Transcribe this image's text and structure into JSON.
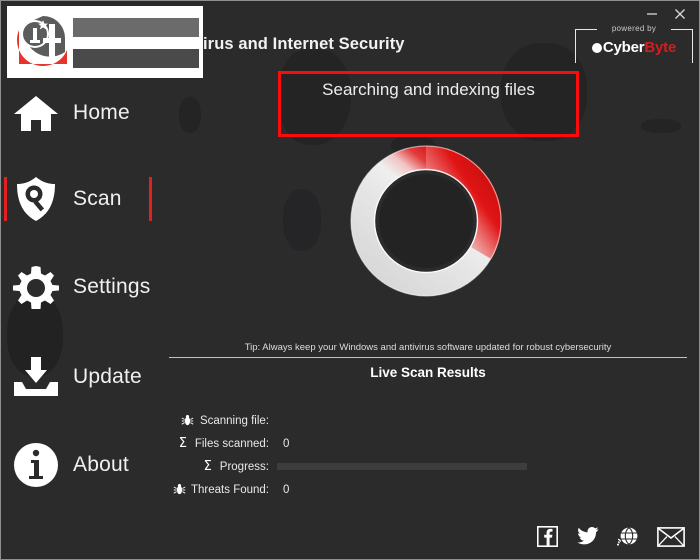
{
  "window": {
    "title": "irus and Internet Security",
    "minimize_label": "—",
    "close_label": "✕"
  },
  "branding": {
    "powered_by_label": "powered by",
    "wordmark_first": "Cyber",
    "wordmark_second": "Byte",
    "accent_red": "#cf1f1f",
    "selection_red": "#e32020",
    "annotation_red": "#fb0b0b",
    "background": "#2b2b2b"
  },
  "sidebar": {
    "items": [
      {
        "id": "home",
        "label": "Home",
        "icon": "home-icon",
        "active": false
      },
      {
        "id": "scan",
        "label": "Scan",
        "icon": "shield-scan-icon",
        "active": true
      },
      {
        "id": "settings",
        "label": "Settings",
        "icon": "gear-icon",
        "active": false
      },
      {
        "id": "update",
        "label": "Update",
        "icon": "download-icon",
        "active": false
      },
      {
        "id": "about",
        "label": "About",
        "icon": "info-icon",
        "active": false
      }
    ]
  },
  "main": {
    "status_text": "Searching and indexing files",
    "tip": "Tip: Always keep your Windows and antivirus software updated for robust cybersecurity",
    "results_heading": "Live Scan Results",
    "spinner": {
      "name": "scan-progress-ring",
      "arc_percent": 28
    },
    "stats": [
      {
        "icon": "bug-icon",
        "label": "Scanning file:",
        "value": ""
      },
      {
        "icon": "sigma-icon",
        "label": "Files scanned:",
        "value": "0"
      },
      {
        "icon": "sigma-icon",
        "label": "Progress:",
        "value": "",
        "progress_percent": 0
      },
      {
        "icon": "bug-icon",
        "label": "Threats Found:",
        "value": "0"
      }
    ]
  },
  "social": {
    "items": [
      {
        "id": "facebook",
        "icon": "facebook-icon"
      },
      {
        "id": "twitter",
        "icon": "twitter-icon"
      },
      {
        "id": "web",
        "icon": "globe-icon"
      },
      {
        "id": "email",
        "icon": "envelope-icon"
      }
    ]
  }
}
